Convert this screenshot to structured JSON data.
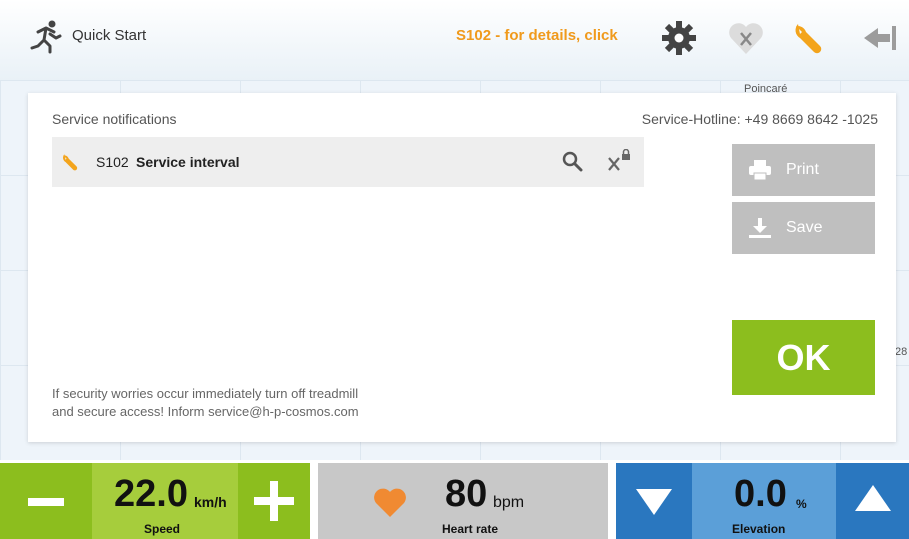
{
  "header": {
    "quick_start_label": "Quick Start",
    "service_alert": "S102 - for details, click",
    "icons": [
      "runner-icon",
      "gear-icon",
      "heart-x-icon",
      "wrench-icon",
      "back-arrow-icon"
    ]
  },
  "background": {
    "frag_top": "Poincaré",
    "frag_side": "28"
  },
  "modal": {
    "title": "Service notifications",
    "hotline": "Service-Hotline: +49 8669 8642 -1025",
    "notifications": [
      {
        "code": "S102",
        "title": "Service interval"
      }
    ],
    "print_label": "Print",
    "save_label": "Save",
    "ok_label": "OK",
    "warning_line1": "If security worries occur immediately turn off treadmill",
    "warning_line2": "and secure access! Inform service@h-p-cosmos.com"
  },
  "controls": {
    "speed": {
      "value": "22.0",
      "unit": "km/h",
      "label": "Speed"
    },
    "heart_rate": {
      "value": "80",
      "unit": "bpm",
      "label": "Heart rate"
    },
    "elevation": {
      "value": "0.0",
      "unit": "%",
      "label": "Elevation"
    }
  },
  "colors": {
    "accent_orange": "#f09a1c",
    "green": "#8cbe1e",
    "blue": "#2a77bf",
    "grey_button": "#bfbfbf"
  }
}
